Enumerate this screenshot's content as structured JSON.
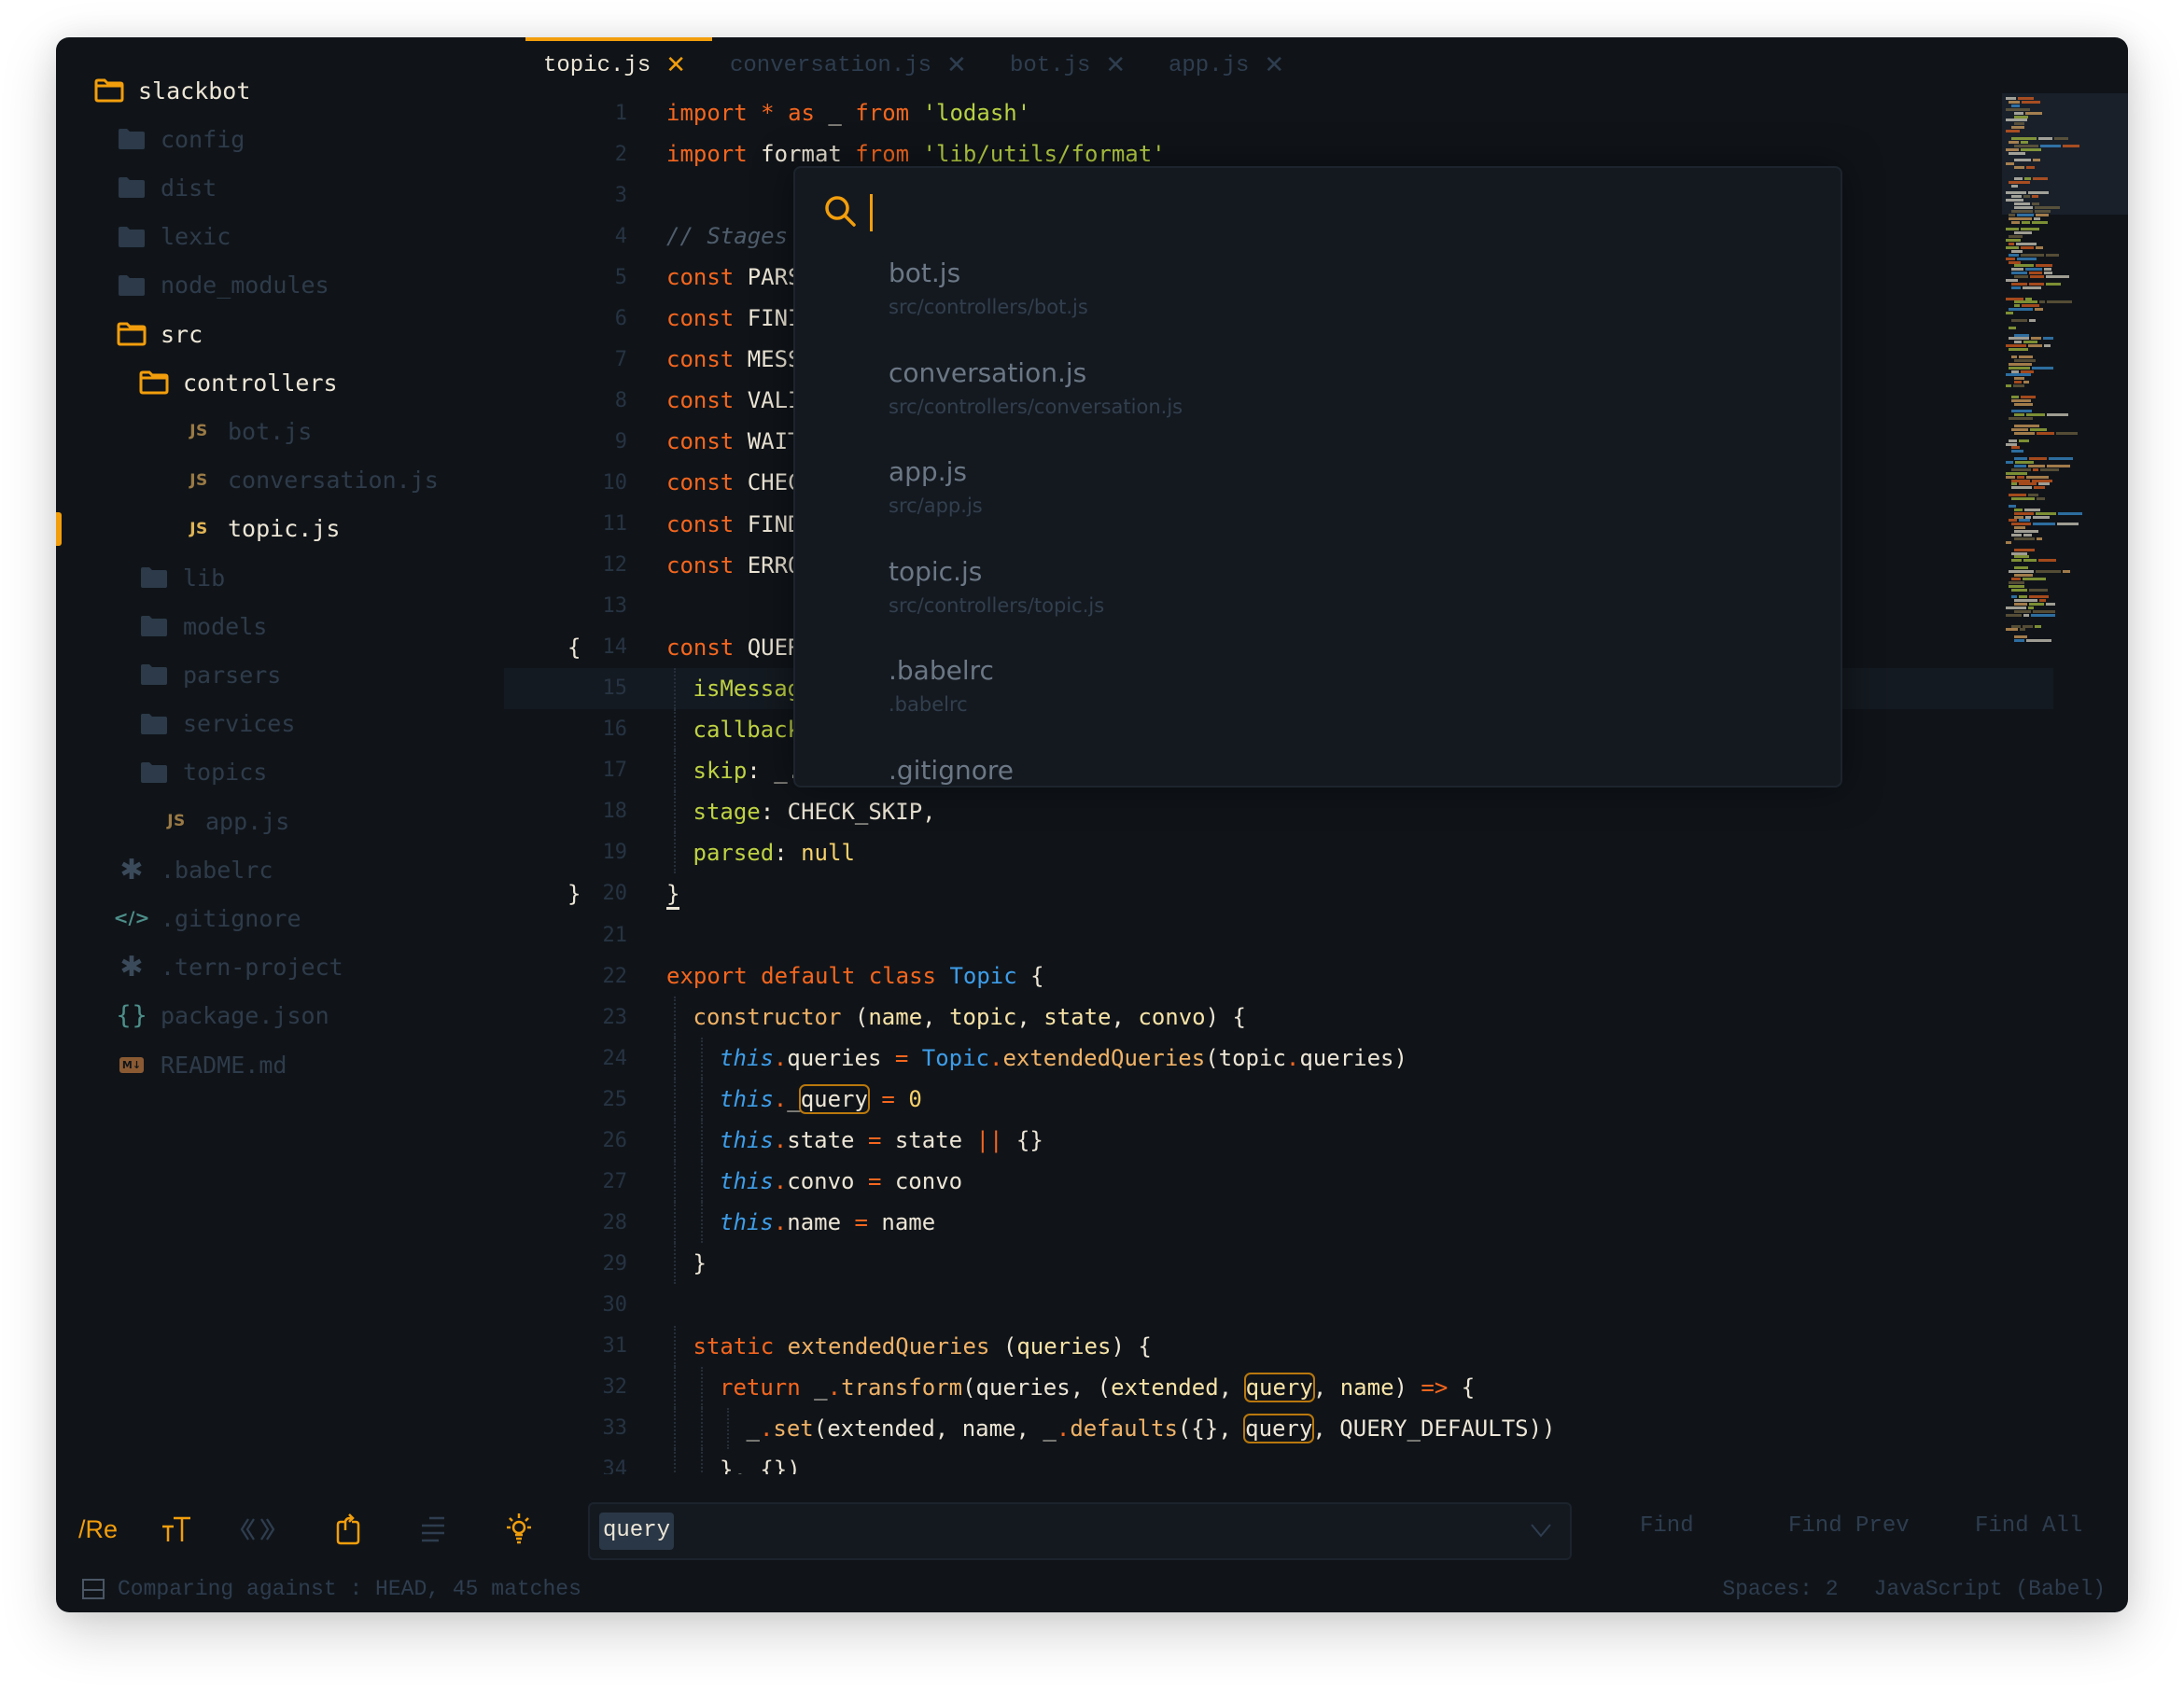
{
  "theme": {
    "accent": "#f29e0c",
    "background": "#101419",
    "foreground": "#ede6d6",
    "muted": "#2e3d4f"
  },
  "sidebar": {
    "items": [
      {
        "label": "slackbot",
        "icon": "folder-open-icon",
        "depth": 0,
        "state": "open"
      },
      {
        "label": "config",
        "icon": "folder-icon",
        "depth": 1,
        "state": "closed"
      },
      {
        "label": "dist",
        "icon": "folder-icon",
        "depth": 1,
        "state": "closed"
      },
      {
        "label": "lexic",
        "icon": "folder-icon",
        "depth": 1,
        "state": "closed"
      },
      {
        "label": "node_modules",
        "icon": "folder-icon",
        "depth": 1,
        "state": "closed"
      },
      {
        "label": "src",
        "icon": "folder-open-icon",
        "depth": 1,
        "state": "open"
      },
      {
        "label": "controllers",
        "icon": "folder-open-icon",
        "depth": 2,
        "state": "open"
      },
      {
        "label": "bot.js",
        "icon": "js-icon",
        "depth": 3,
        "state": "file"
      },
      {
        "label": "conversation.js",
        "icon": "js-icon",
        "depth": 3,
        "state": "file"
      },
      {
        "label": "topic.js",
        "icon": "js-icon",
        "depth": 3,
        "state": "active"
      },
      {
        "label": "lib",
        "icon": "folder-icon",
        "depth": 2,
        "state": "closed"
      },
      {
        "label": "models",
        "icon": "folder-icon",
        "depth": 2,
        "state": "closed"
      },
      {
        "label": "parsers",
        "icon": "folder-icon",
        "depth": 2,
        "state": "closed"
      },
      {
        "label": "services",
        "icon": "folder-icon",
        "depth": 2,
        "state": "closed"
      },
      {
        "label": "topics",
        "icon": "folder-icon",
        "depth": 2,
        "state": "closed"
      },
      {
        "label": "app.js",
        "icon": "js-icon",
        "depth": 2,
        "state": "file"
      },
      {
        "label": ".babelrc",
        "icon": "asterisk-icon",
        "depth": 1,
        "state": "file"
      },
      {
        "label": ".gitignore",
        "icon": "code-icon",
        "depth": 1,
        "state": "file"
      },
      {
        "label": ".tern-project",
        "icon": "asterisk-icon",
        "depth": 1,
        "state": "file"
      },
      {
        "label": "package.json",
        "icon": "braces-icon",
        "depth": 1,
        "state": "file"
      },
      {
        "label": "README.md",
        "icon": "markdown-icon",
        "depth": 1,
        "state": "file"
      }
    ],
    "js_badge": "JS",
    "md_badge": "M↓"
  },
  "tabs": [
    {
      "label": "topic.js",
      "active": true
    },
    {
      "label": "conversation.js",
      "active": false
    },
    {
      "label": "bot.js",
      "active": false
    },
    {
      "label": "app.js",
      "active": false
    }
  ],
  "tab_close_glyph": "✕",
  "editor": {
    "highlighted_line": 15,
    "lines": [
      {
        "n": "1",
        "tokens": [
          [
            "k",
            "import"
          ],
          [
            "d",
            " "
          ],
          [
            "o",
            "*"
          ],
          [
            "d",
            " "
          ],
          [
            "k",
            "as"
          ],
          [
            "d",
            " _ "
          ],
          [
            "k",
            "from"
          ],
          [
            "d",
            " "
          ],
          [
            "s",
            "'lodash'"
          ]
        ]
      },
      {
        "n": "2",
        "tokens": [
          [
            "k",
            "import"
          ],
          [
            "d",
            " format "
          ],
          [
            "k",
            "from"
          ],
          [
            "d",
            " "
          ],
          [
            "s",
            "'lib/utils/format'"
          ]
        ]
      },
      {
        "n": "3",
        "tokens": []
      },
      {
        "n": "4",
        "tokens": [
          [
            "c",
            "// Stages"
          ]
        ]
      },
      {
        "n": "5",
        "tokens": [
          [
            "k",
            "const"
          ],
          [
            "d",
            " PARSE "
          ],
          [
            "o",
            "="
          ]
        ]
      },
      {
        "n": "6",
        "tokens": [
          [
            "k",
            "const"
          ],
          [
            "d",
            " FINISH "
          ],
          [
            "o",
            "="
          ]
        ]
      },
      {
        "n": "7",
        "tokens": [
          [
            "k",
            "const"
          ],
          [
            "d",
            " MESSAGE"
          ]
        ]
      },
      {
        "n": "8",
        "tokens": [
          [
            "k",
            "const"
          ],
          [
            "d",
            " VALIDATE"
          ]
        ]
      },
      {
        "n": "9",
        "tokens": [
          [
            "k",
            "const"
          ],
          [
            "d",
            " WAIT_USE"
          ]
        ]
      },
      {
        "n": "10",
        "tokens": [
          [
            "k",
            "const"
          ],
          [
            "d",
            " CHECK_SK"
          ]
        ]
      },
      {
        "n": "11",
        "tokens": [
          [
            "k",
            "const"
          ],
          [
            "d",
            " FIND_BRA"
          ]
        ]
      },
      {
        "n": "12",
        "tokens": [
          [
            "k",
            "const"
          ],
          [
            "d",
            " ERROR_ME"
          ]
        ]
      },
      {
        "n": "13",
        "tokens": []
      },
      {
        "n": "14",
        "fold": "{",
        "tokens": [
          [
            "k",
            "const"
          ],
          [
            "d",
            " QUERY_DE"
          ]
        ]
      },
      {
        "n": "15",
        "indent": 1,
        "tokens": [
          [
            "p",
            "isMessageSen"
          ]
        ]
      },
      {
        "n": "16",
        "indent": 1,
        "tokens": [
          [
            "p",
            "callback"
          ],
          [
            "d",
            ": _."
          ]
        ]
      },
      {
        "n": "17",
        "indent": 1,
        "tokens": [
          [
            "p",
            "skip"
          ],
          [
            "d",
            ": _.stub"
          ]
        ]
      },
      {
        "n": "18",
        "indent": 1,
        "tokens": [
          [
            "p",
            "stage"
          ],
          [
            "d",
            ": CHECK_SKIP,"
          ]
        ]
      },
      {
        "n": "19",
        "indent": 1,
        "tokens": [
          [
            "p",
            "parsed"
          ],
          [
            "d",
            ": "
          ],
          [
            "n",
            "null"
          ]
        ]
      },
      {
        "n": "20",
        "fold": "}",
        "tokens": [
          [
            "cur",
            "}"
          ]
        ]
      },
      {
        "n": "21",
        "tokens": []
      },
      {
        "n": "22",
        "tokens": [
          [
            "k",
            "export default class"
          ],
          [
            "d",
            " "
          ],
          [
            "cls",
            "Topic"
          ],
          [
            "d",
            " {"
          ]
        ]
      },
      {
        "n": "23",
        "indent": 1,
        "tokens": [
          [
            "f",
            "constructor"
          ],
          [
            "d",
            " ("
          ],
          [
            "prm",
            "name"
          ],
          [
            "d",
            ", "
          ],
          [
            "prm",
            "topic"
          ],
          [
            "d",
            ", "
          ],
          [
            "prm",
            "state"
          ],
          [
            "d",
            ", "
          ],
          [
            "prm",
            "convo"
          ],
          [
            "d",
            ") {"
          ]
        ]
      },
      {
        "n": "24",
        "indent": 2,
        "tokens": [
          [
            "t",
            "this"
          ],
          [
            "o",
            "."
          ],
          [
            "d",
            "queries "
          ],
          [
            "o",
            "="
          ],
          [
            "d",
            " "
          ],
          [
            "cls",
            "Topic"
          ],
          [
            "o",
            "."
          ],
          [
            "f",
            "extendedQueries"
          ],
          [
            "d",
            "(topic"
          ],
          [
            "o",
            "."
          ],
          [
            "d",
            "queries)"
          ]
        ]
      },
      {
        "n": "25",
        "indent": 2,
        "tokens": [
          [
            "t",
            "this"
          ],
          [
            "o",
            "."
          ],
          [
            "d",
            "_"
          ],
          [
            "m",
            "query"
          ],
          [
            "d",
            " "
          ],
          [
            "o",
            "="
          ],
          [
            "d",
            " "
          ],
          [
            "n",
            "0"
          ]
        ]
      },
      {
        "n": "26",
        "indent": 2,
        "tokens": [
          [
            "t",
            "this"
          ],
          [
            "o",
            "."
          ],
          [
            "d",
            "state "
          ],
          [
            "o",
            "="
          ],
          [
            "d",
            " state "
          ],
          [
            "o",
            "||"
          ],
          [
            "d",
            " {}"
          ]
        ]
      },
      {
        "n": "27",
        "indent": 2,
        "tokens": [
          [
            "t",
            "this"
          ],
          [
            "o",
            "."
          ],
          [
            "d",
            "convo "
          ],
          [
            "o",
            "="
          ],
          [
            "d",
            " convo"
          ]
        ]
      },
      {
        "n": "28",
        "indent": 2,
        "tokens": [
          [
            "t",
            "this"
          ],
          [
            "o",
            "."
          ],
          [
            "d",
            "name "
          ],
          [
            "o",
            "="
          ],
          [
            "d",
            " name"
          ]
        ]
      },
      {
        "n": "29",
        "indent": 1,
        "tokens": [
          [
            "d",
            "}"
          ]
        ]
      },
      {
        "n": "30",
        "tokens": []
      },
      {
        "n": "31",
        "indent": 1,
        "tokens": [
          [
            "k",
            "static"
          ],
          [
            "d",
            " "
          ],
          [
            "f",
            "extendedQueries"
          ],
          [
            "d",
            " ("
          ],
          [
            "prm",
            "queries"
          ],
          [
            "d",
            ") {"
          ]
        ]
      },
      {
        "n": "32",
        "indent": 2,
        "tokens": [
          [
            "k",
            "return"
          ],
          [
            "d",
            " _"
          ],
          [
            "o",
            "."
          ],
          [
            "f",
            "transform"
          ],
          [
            "d",
            "(queries, ("
          ],
          [
            "prm",
            "extended"
          ],
          [
            "d",
            ", "
          ],
          [
            "mp",
            "query"
          ],
          [
            "d",
            ", "
          ],
          [
            "prm",
            "name"
          ],
          [
            "d",
            ") "
          ],
          [
            "o",
            "=>"
          ],
          [
            "d",
            " {"
          ]
        ]
      },
      {
        "n": "33",
        "indent": 3,
        "tokens": [
          [
            "d",
            "_"
          ],
          [
            "o",
            "."
          ],
          [
            "f",
            "set"
          ],
          [
            "d",
            "(extended, name, _"
          ],
          [
            "o",
            "."
          ],
          [
            "f",
            "defaults"
          ],
          [
            "d",
            "({}, "
          ],
          [
            "m",
            "query"
          ],
          [
            "d",
            ", QUERY_DEFAULTS))"
          ]
        ]
      },
      {
        "n": "34",
        "indent": 2,
        "tokens": [
          [
            "d",
            "}, {})"
          ]
        ]
      }
    ]
  },
  "quick_open": {
    "query": "",
    "results": [
      {
        "name": "bot.js",
        "path": "src/controllers/bot.js"
      },
      {
        "name": "conversation.js",
        "path": "src/controllers/conversation.js"
      },
      {
        "name": "app.js",
        "path": "src/app.js"
      },
      {
        "name": "topic.js",
        "path": "src/controllers/topic.js"
      },
      {
        "name": ".babelrc",
        "path": ".babelrc"
      },
      {
        "name": ".gitignore",
        "path": ""
      }
    ]
  },
  "findbar": {
    "toggles": [
      {
        "name": "regex-toggle",
        "label": "/Re",
        "on": true
      },
      {
        "name": "case-toggle",
        "label": "тT",
        "on": true
      },
      {
        "name": "whole-word-toggle",
        "label": "《》",
        "on": false
      },
      {
        "name": "wrap-toggle",
        "label": "wrap",
        "on": true
      },
      {
        "name": "in-selection-toggle",
        "label": "selection",
        "on": false
      },
      {
        "name": "highlight-matches-toggle",
        "label": "highlight",
        "on": true
      }
    ],
    "input_value": "query",
    "buttons": {
      "find": "Find",
      "find_prev": "Find Prev",
      "find_all": "Find All"
    }
  },
  "statusbar": {
    "message": "Comparing against : HEAD, 45 matches",
    "indent": "Spaces: 2",
    "syntax": "JavaScript (Babel)"
  }
}
